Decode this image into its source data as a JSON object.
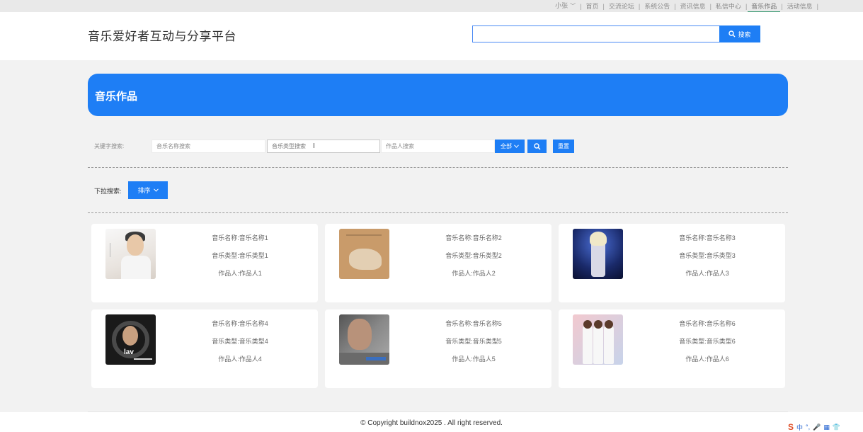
{
  "topnav": {
    "user": "小张",
    "items": [
      "首页",
      "交流论坛",
      "系统公告",
      "资讯信息",
      "私信中心",
      "音乐作品",
      "活动信息"
    ],
    "active": "音乐作品"
  },
  "header": {
    "site_title": "音乐爱好者互动与分享平台",
    "search_value": "",
    "search_label": "搜索"
  },
  "banner": {
    "title": "音乐作品"
  },
  "keyword_search": {
    "label": "关键字搜索:",
    "name_placeholder": "音乐名称搜索",
    "type_placeholder": "音乐类型搜索",
    "author_placeholder": "作品人搜索",
    "all_label": "全部",
    "reset_label": "重置"
  },
  "dropdown_search": {
    "label": "下拉搜索:",
    "sort_label": "排序"
  },
  "works": [
    {
      "name": "音乐名称:音乐名称1",
      "type": "音乐类型:音乐类型1",
      "author": "作品人:作品人1"
    },
    {
      "name": "音乐名称:音乐名称2",
      "type": "音乐类型:音乐类型2",
      "author": "作品人:作品人2"
    },
    {
      "name": "音乐名称:音乐名称3",
      "type": "音乐类型:音乐类型3",
      "author": "作品人:作品人3"
    },
    {
      "name": "音乐名称:音乐名称4",
      "type": "音乐类型:音乐类型4",
      "author": "作品人:作品人4"
    },
    {
      "name": "音乐名称:音乐名称5",
      "type": "音乐类型:音乐类型5",
      "author": "作品人:作品人5"
    },
    {
      "name": "音乐名称:音乐名称6",
      "type": "音乐类型:音乐类型6",
      "author": "作品人:作品人6"
    }
  ],
  "cover_labels": {
    "cover4": "lav"
  },
  "footer": {
    "copyright": "© Copyright buildnox2025 . All right reserved.",
    "ime": "中"
  },
  "colors": {
    "accent": "#1e7ef5",
    "active_underline": "#3b9b73"
  }
}
